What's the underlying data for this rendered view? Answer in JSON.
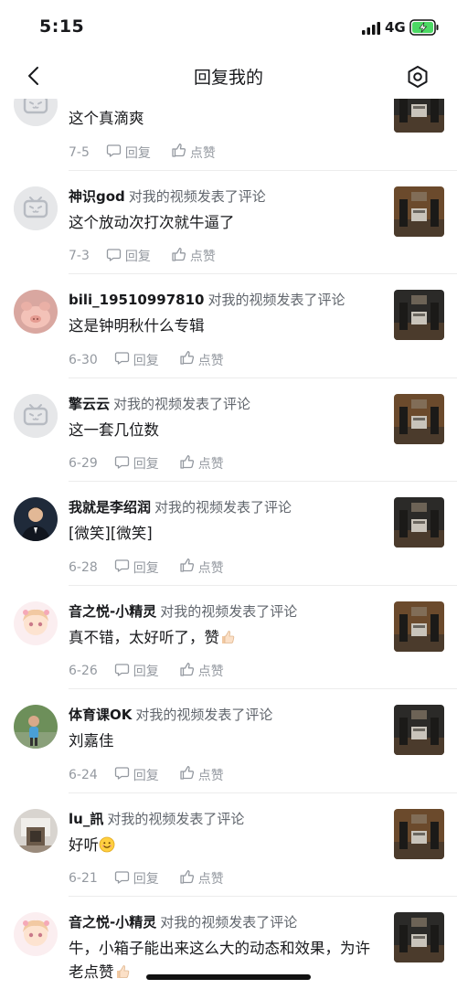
{
  "status_bar": {
    "time": "5:15",
    "network": "4G"
  },
  "nav": {
    "title": "回复我的"
  },
  "labels": {
    "reply": "回复",
    "like": "点赞"
  },
  "colors": {
    "thumb_dark": "#2b2a28",
    "thumb_warm": "#6b4a2c",
    "default_avatar_bg": "#e6e7e9"
  },
  "items": [
    {
      "username": "",
      "action": "",
      "content": "这个真滴爽",
      "date": "7-5",
      "avatar": "tv-default-icon"
    },
    {
      "username": "神识god",
      "action": "对我的视频发表了评论",
      "content": "这个放动次打次就牛逼了",
      "date": "7-3",
      "avatar": "tv-default-icon"
    },
    {
      "username": "bili_19510997810",
      "action": "对我的视频发表了评论",
      "content": "这是钟明秋什么专辑",
      "date": "6-30",
      "avatar": "pig-avatar"
    },
    {
      "username": "擎云云",
      "action": "对我的视频发表了评论",
      "content": "这一套几位数",
      "date": "6-29",
      "avatar": "tv-default-icon"
    },
    {
      "username": "我就是李绍润",
      "action": "对我的视频发表了评论",
      "content": "[微笑][微笑]",
      "date": "6-28",
      "avatar": "man-avatar"
    },
    {
      "username": "音之悦-小精灵",
      "action": "对我的视频发表了评论",
      "content": "真不错，太好听了，赞",
      "date": "6-26",
      "avatar": "anime-avatar",
      "emoji": "thumbs-up-icon"
    },
    {
      "username": "体育课OK",
      "action": "对我的视频发表了评论",
      "content": "刘嘉佳",
      "date": "6-24",
      "avatar": "child-avatar"
    },
    {
      "username": "lu_訊",
      "action": "对我的视频发表了评论",
      "content": "好听",
      "date": "6-21",
      "avatar": "room-avatar",
      "emoji": "smile-icon"
    },
    {
      "username": "音之悦-小精灵",
      "action": "对我的视频发表了评论",
      "content": "牛，小箱子能出来这么大的动态和效果，为许老点赞",
      "date": "",
      "avatar": "anime-avatar",
      "emoji": "thumbs-up-icon"
    }
  ]
}
